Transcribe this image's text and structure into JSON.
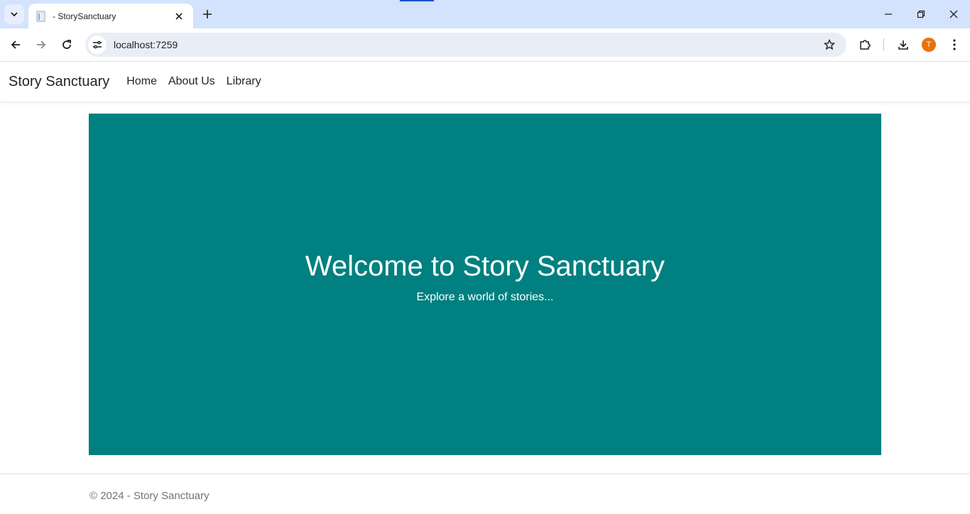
{
  "browser": {
    "tab_title": "- StorySanctuary",
    "url": "localhost:7259",
    "avatar_initial": "T"
  },
  "navbar": {
    "brand": "Story Sanctuary",
    "links": [
      "Home",
      "About Us",
      "Library"
    ]
  },
  "hero": {
    "title": "Welcome to Story Sanctuary",
    "subtitle": "Explore a world of stories...",
    "background_color": "#008080"
  },
  "footer": {
    "text": "© 2024 - Story Sanctuary"
  }
}
